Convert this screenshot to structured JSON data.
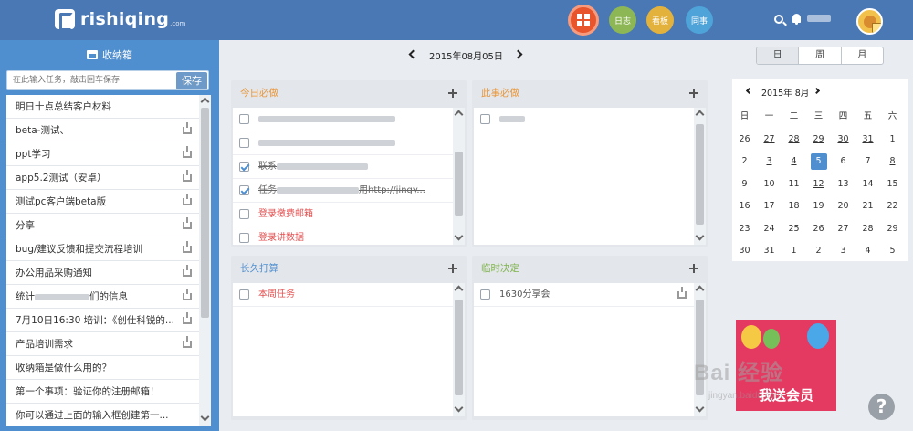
{
  "header": {
    "logo_text": "rishiqing",
    "logo_suffix": ".com",
    "nav": {
      "log": "日志",
      "board": "看板",
      "share": "同事"
    },
    "icons": [
      "grid-icon",
      "search-icon",
      "bell-icon"
    ],
    "accent_color": "#4a78b5"
  },
  "sidebar": {
    "title": "收纳箱",
    "input_placeholder": "在此输入任务，敲击回车保存",
    "save_label": "保存",
    "items": [
      {
        "label": "明日十点总结客户材料",
        "dl": false
      },
      {
        "label": "beta-测试、",
        "dl": true
      },
      {
        "label": "ppt学习",
        "dl": true
      },
      {
        "label": "app5.2测试（安卓）",
        "dl": true
      },
      {
        "label": "测试pc客户端beta版",
        "dl": true
      },
      {
        "label": "分享",
        "dl": true
      },
      {
        "label": "bug/建议反馈和提交流程培训",
        "dl": true
      },
      {
        "label": "办公用品采购通知",
        "dl": true
      },
      {
        "label": "统计",
        "label_tail": "们的信息",
        "dl": true
      },
      {
        "label": "7月10日16:30 培训：《创仕科锐的...",
        "dl": true
      },
      {
        "label": "产品培训需求",
        "dl": true
      },
      {
        "label": "收纳箱是做什么用的？",
        "dl": false
      },
      {
        "label": "第一个事项：验证你的注册邮箱！",
        "dl": false
      },
      {
        "label": "你可以通过上面的输入框创建第一...",
        "dl": false
      }
    ]
  },
  "date_nav": {
    "current_date": "2015年08月05日"
  },
  "view_switch": {
    "day": "日",
    "week": "周",
    "month": "月"
  },
  "panels": {
    "today_must": {
      "title": "今日必做",
      "color": "#e8963a",
      "tasks": [
        {
          "prefix": "",
          "suffix": "",
          "checked": false,
          "red": false
        },
        {
          "prefix": "",
          "suffix": "",
          "checked": false,
          "red": false
        },
        {
          "prefix": "联系",
          "suffix": "",
          "checked": true,
          "red": false
        },
        {
          "prefix": "任务",
          "suffix": "用http://jingy...",
          "checked": true,
          "red": false
        },
        {
          "prefix": "登录缴费邮箱",
          "suffix": "",
          "checked": false,
          "red": true
        },
        {
          "prefix": "登录讲数据",
          "suffix": "",
          "checked": false,
          "red": true
        }
      ]
    },
    "this_must": {
      "title": "此事必做",
      "color": "#e8963a",
      "tasks": [
        {
          "prefix": "",
          "suffix": "",
          "checked": false,
          "red": false
        }
      ]
    },
    "long_plan": {
      "title": "长久打算",
      "color": "#4f8fd0",
      "tasks": [
        {
          "prefix": "本周任务",
          "suffix": "",
          "checked": false,
          "red": true
        }
      ]
    },
    "temp_decide": {
      "title": "临时决定",
      "color": "#7fb34d",
      "tasks": [
        {
          "prefix": "1630分享会",
          "suffix": "",
          "checked": false,
          "red": false,
          "dl": true
        }
      ]
    }
  },
  "calendar": {
    "month_label": "2015年 8月",
    "weekdays": [
      "日",
      "一",
      "二",
      "三",
      "四",
      "五",
      "六"
    ],
    "days": [
      [
        "26",
        "27",
        "28",
        "29",
        "30",
        "31",
        "1"
      ],
      [
        "2",
        "3",
        "4",
        "5",
        "6",
        "7",
        "8"
      ],
      [
        "9",
        "10",
        "11",
        "12",
        "13",
        "14",
        "15"
      ],
      [
        "16",
        "17",
        "18",
        "19",
        "20",
        "21",
        "22"
      ],
      [
        "23",
        "24",
        "25",
        "26",
        "27",
        "28",
        "29"
      ],
      [
        "30",
        "31",
        "1",
        "2",
        "3",
        "4",
        "5"
      ]
    ],
    "underlined": [
      "1-6",
      "1-1",
      "1-2",
      "1-3",
      "0-1",
      "0-2",
      "0-3",
      "0-4",
      "0-5",
      "2-3"
    ],
    "today": "1-3"
  },
  "promo": {
    "text": "我送会员"
  },
  "watermark": {
    "text": "Bai 经验",
    "sub": "jingyan.baidu.com"
  },
  "help_label": "?"
}
